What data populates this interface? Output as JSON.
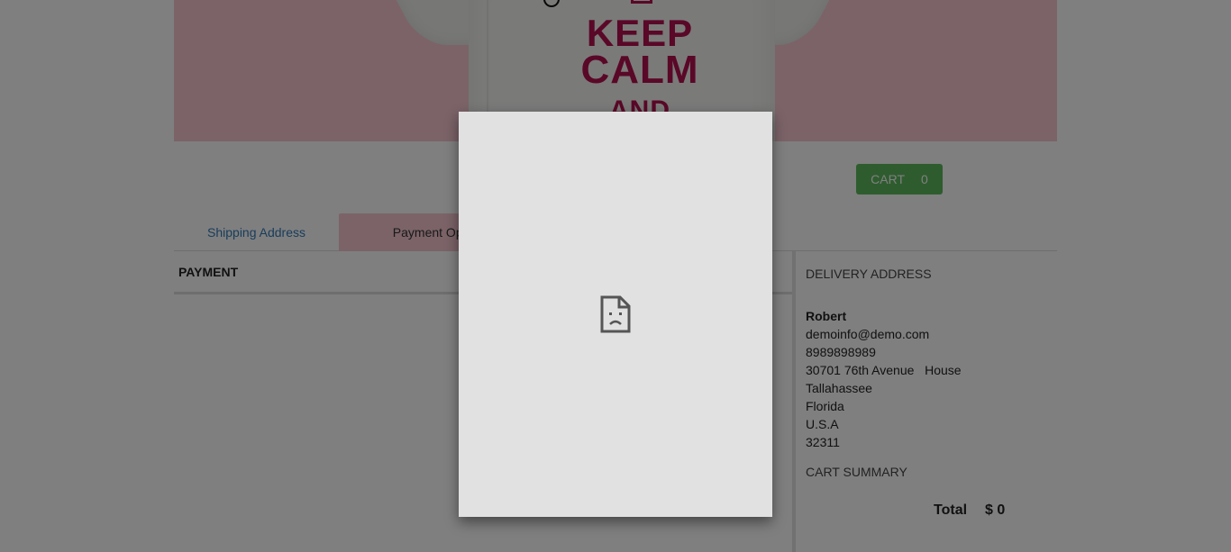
{
  "hero": {
    "line1": "KEEP",
    "line2": "CALM",
    "line3": "AND"
  },
  "cart": {
    "label": "CART",
    "count": "0"
  },
  "tabs": [
    {
      "label": "Shipping Address"
    },
    {
      "label": "Payment Option"
    }
  ],
  "payment": {
    "heading": "PAYMENT"
  },
  "delivery": {
    "heading": "DELIVERY ADDRESS",
    "name": "Robert",
    "email": "demoinfo@demo.com",
    "phone": "8989898989",
    "street": "30701 76th Avenue   House",
    "city": "Tallahassee",
    "state": "Florida",
    "country": "U.S.A",
    "zip": "32311"
  },
  "cart_summary": {
    "heading": "CART SUMMARY",
    "total_label": "Total",
    "total_value": "$ 0"
  },
  "modal": {
    "icon": "broken-page-icon"
  },
  "colors": {
    "hero_bg": "#f7c7d0",
    "brand_text": "#b5104f",
    "cart_green": "#5cb85c",
    "link_blue": "#337ab7"
  }
}
